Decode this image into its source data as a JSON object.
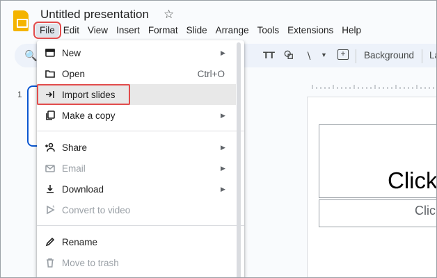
{
  "app": {
    "document_title": "Untitled presentation",
    "icons": {
      "logo": "slides-logo-icon",
      "star": "star-icon"
    }
  },
  "menubar": {
    "items": [
      "File",
      "Edit",
      "View",
      "Insert",
      "Format",
      "Slide",
      "Arrange",
      "Tools",
      "Extensions",
      "Help"
    ],
    "active": "File"
  },
  "toolbar": {
    "text_icon": "TT",
    "background_label": "Background",
    "layout_label": "Layo"
  },
  "filmstrip": {
    "slide_number": "1"
  },
  "slide": {
    "title_placeholder": "Click",
    "subtitle_placeholder": "Clic"
  },
  "file_menu": {
    "items": [
      {
        "label": "New",
        "icon": "presentation-icon",
        "submenu": true,
        "disabled": false
      },
      {
        "label": "Open",
        "icon": "folder-icon",
        "shortcut": "Ctrl+O",
        "disabled": false
      },
      {
        "label": "Import slides",
        "icon": "import-icon",
        "disabled": false,
        "highlighted": true
      },
      {
        "label": "Make a copy",
        "icon": "copy-icon",
        "submenu": true,
        "disabled": false
      },
      {
        "label": "Share",
        "icon": "person-add-icon",
        "submenu": true,
        "disabled": false
      },
      {
        "label": "Email",
        "icon": "email-icon",
        "submenu": true,
        "disabled": true
      },
      {
        "label": "Download",
        "icon": "download-icon",
        "submenu": true,
        "disabled": false
      },
      {
        "label": "Convert to video",
        "icon": "video-icon",
        "disabled": true
      },
      {
        "label": "Rename",
        "icon": "pencil-icon",
        "disabled": false
      },
      {
        "label": "Move to trash",
        "icon": "trash-icon",
        "disabled": true
      }
    ]
  },
  "colors": {
    "highlight_outline": "#e24c4c",
    "selection_blue": "#0b57d0",
    "logo_yellow": "#f4b400"
  }
}
